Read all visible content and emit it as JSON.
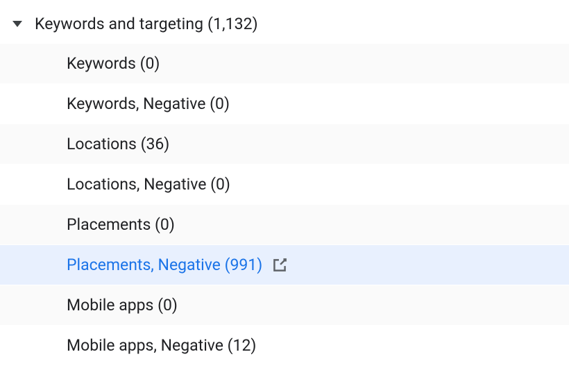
{
  "tree": {
    "parent": {
      "label": "Keywords and targeting",
      "count": "1,132"
    },
    "children": [
      {
        "label": "Keywords",
        "count": "0",
        "alt": true,
        "selected": false,
        "ext": false
      },
      {
        "label": "Keywords, Negative",
        "count": "0",
        "alt": false,
        "selected": false,
        "ext": false
      },
      {
        "label": "Locations",
        "count": "36",
        "alt": true,
        "selected": false,
        "ext": false
      },
      {
        "label": "Locations, Negative",
        "count": "0",
        "alt": false,
        "selected": false,
        "ext": false
      },
      {
        "label": "Placements",
        "count": "0",
        "alt": true,
        "selected": false,
        "ext": false
      },
      {
        "label": "Placements, Negative",
        "count": "991",
        "alt": false,
        "selected": true,
        "ext": true
      },
      {
        "label": "Mobile apps",
        "count": "0",
        "alt": true,
        "selected": false,
        "ext": false
      },
      {
        "label": "Mobile apps, Negative",
        "count": "12",
        "alt": false,
        "selected": false,
        "ext": false
      }
    ]
  }
}
